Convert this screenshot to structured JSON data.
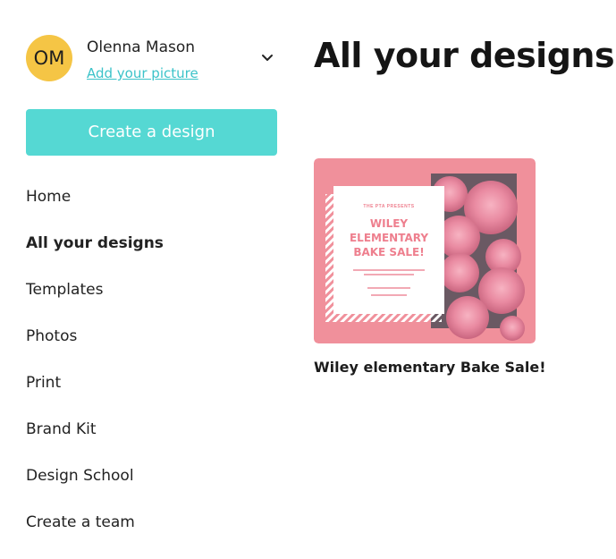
{
  "user": {
    "initials": "OM",
    "name": "Olenna Mason",
    "add_picture_label": "Add your picture"
  },
  "sidebar": {
    "create_label": "Create a design",
    "items": [
      {
        "label": "Home",
        "active": false
      },
      {
        "label": "All your designs",
        "active": true
      },
      {
        "label": "Templates",
        "active": false
      },
      {
        "label": "Photos",
        "active": false
      },
      {
        "label": "Print",
        "active": false
      },
      {
        "label": "Brand Kit",
        "active": false
      },
      {
        "label": "Design School",
        "active": false
      },
      {
        "label": "Create a team",
        "active": false
      }
    ]
  },
  "main": {
    "title": "All your designs",
    "designs": [
      {
        "title": "Wiley elementary Bake Sale!",
        "thumbnail": {
          "kicker": "THE PTA PRESENTS",
          "headline_lines": [
            "WILEY",
            "ELEMENTARY",
            "BAKE SALE!"
          ]
        }
      }
    ]
  },
  "colors": {
    "accent": "#55d8d3",
    "link": "#3cc3c9",
    "avatar": "#f5c545",
    "card_pink": "#f0909b",
    "headline_pink": "#ee7f8e"
  },
  "icons": {
    "account_menu": "chevron-down-icon"
  }
}
